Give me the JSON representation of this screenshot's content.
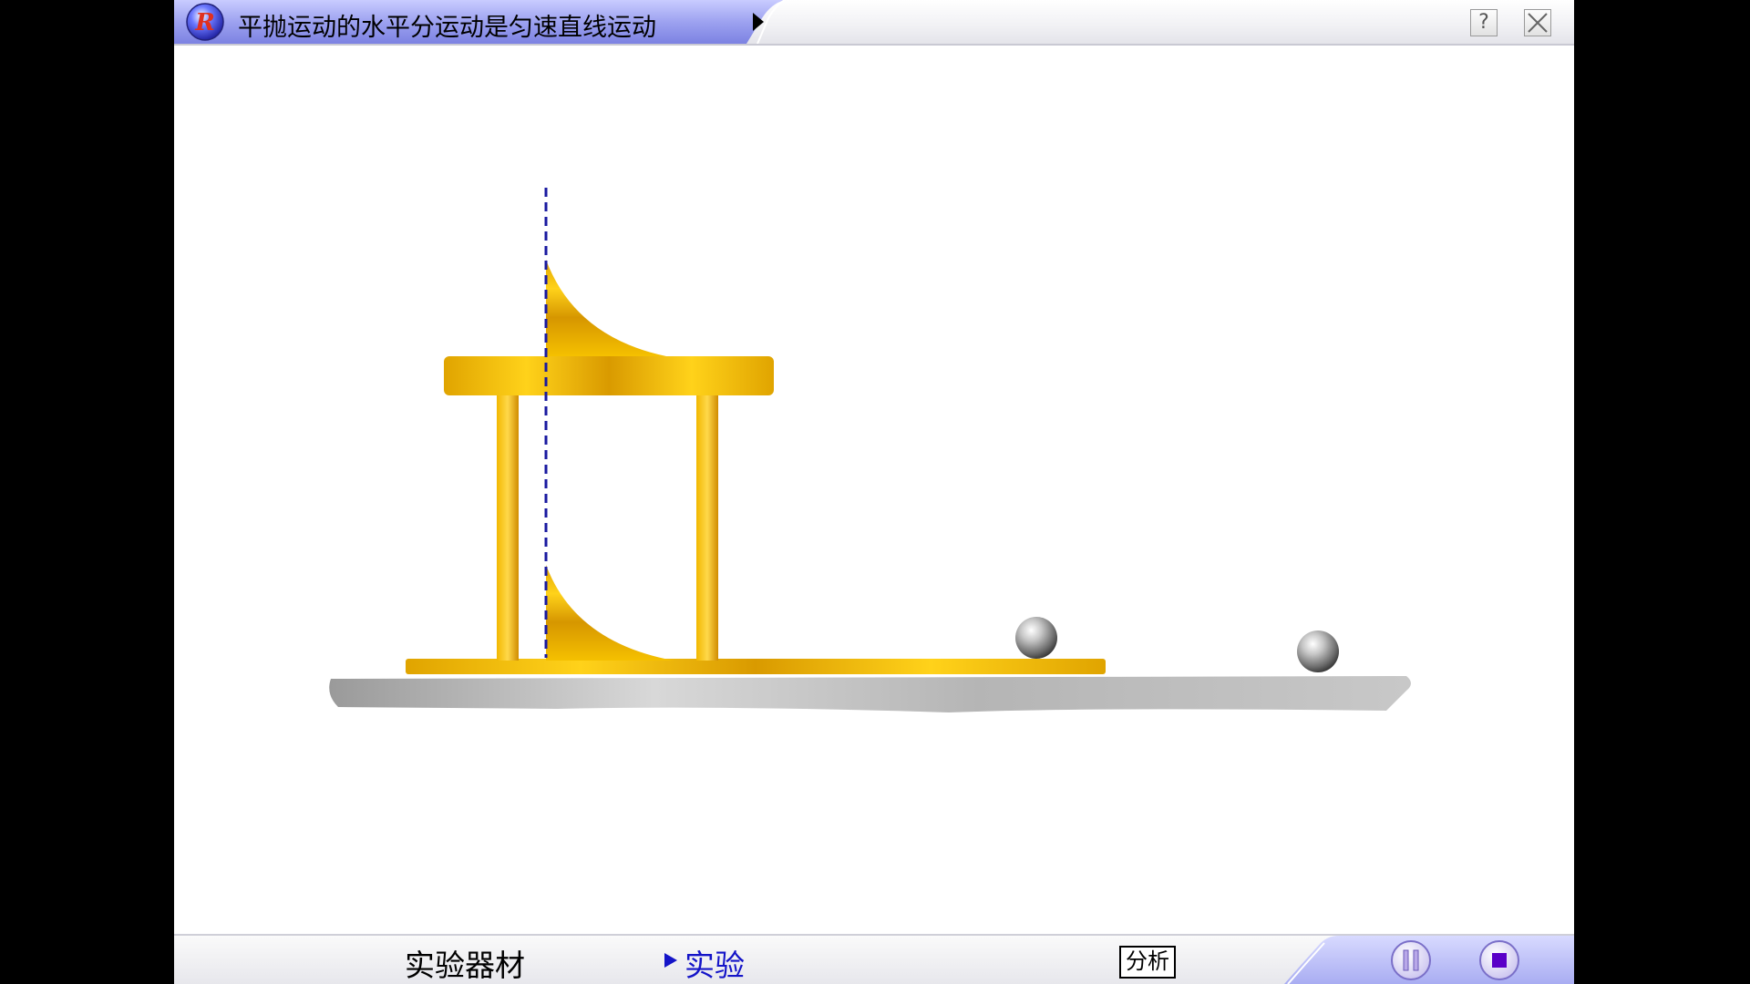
{
  "titlebar": {
    "title": "平抛运动的水平分运动是匀速直线运动",
    "logo_icon": "r-logo-icon",
    "next_icon": "triangle-right-icon",
    "help_label": "?",
    "close_icon": "close-x-icon"
  },
  "bottombar": {
    "tabs": [
      {
        "label": "实验器材",
        "active": false
      },
      {
        "label": "实验",
        "active": true
      }
    ],
    "active_marker_icon": "triangle-right-icon",
    "analyze_label": "分析",
    "pause_icon": "pause-icon",
    "stop_icon": "stop-icon"
  },
  "colors": {
    "accent_active_tab": "#1414c8",
    "title_tab": "#8a8ee8",
    "apparatus_gold": "#e8b000",
    "ground_gray": "#bdbdbd",
    "guide_line": "#1a1aa0",
    "stop_square": "#5a00c8"
  }
}
